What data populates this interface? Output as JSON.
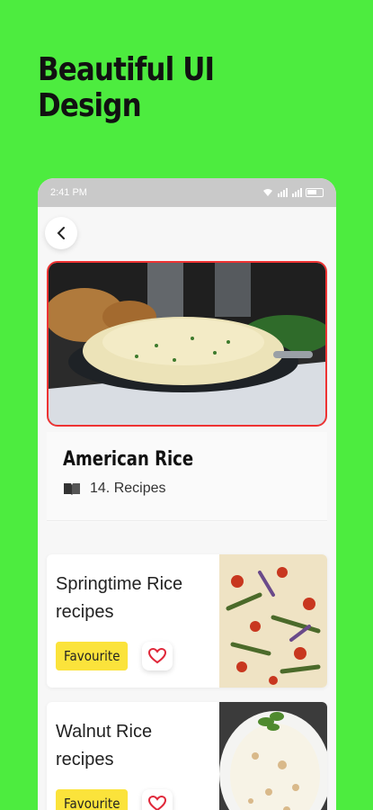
{
  "promo": {
    "line1": "Beautiful UI",
    "line2": "Design"
  },
  "status_bar": {
    "time": "2:41 PM"
  },
  "header": {
    "back_icon": "chevron-left-icon"
  },
  "category": {
    "title": "American Rice",
    "count_label": "14. Recipes",
    "icon": "book-icon"
  },
  "recipes": [
    {
      "name_line1": "Springtime Rice",
      "name_line2": "recipes",
      "badge": "Favourite"
    },
    {
      "name_line1": "Walnut Rice",
      "name_line2": "recipes",
      "badge": "Favourite"
    }
  ],
  "colors": {
    "background": "#4dec3f",
    "badge": "#fbe33b",
    "heart": "#e0283a",
    "hero_border": "#e33333"
  }
}
